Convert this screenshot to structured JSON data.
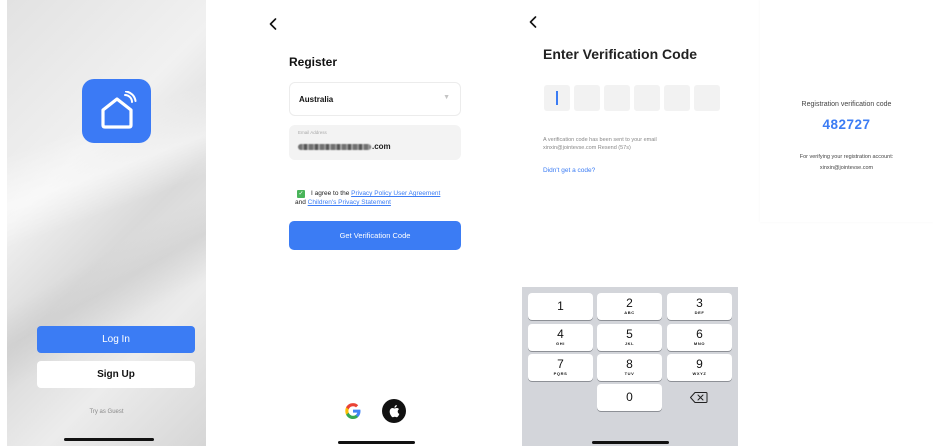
{
  "splash": {
    "login_label": "Log In",
    "signup_label": "Sign Up",
    "guest_label": "Try as Guest",
    "logo_icon": "smart-home-icon",
    "accent_color": "#3b7cf4"
  },
  "register": {
    "back_icon": "chevron-left-icon",
    "title": "Register",
    "country": "Australia",
    "email_placeholder": "Email Address",
    "email_value_visible": ".com",
    "agree_prefix": "I agree to the",
    "privacy_link": "Privacy Policy User Agreement",
    "and_text": "and",
    "children_link": "Children's Privacy Statement",
    "verify_button": "Get Verification Code",
    "social": [
      "google-icon",
      "apple-icon"
    ]
  },
  "verify": {
    "back_icon": "chevron-left-icon",
    "title": "Enter Verification Code",
    "code_length": 6,
    "sent_line1": "A verification code has been sent to your email",
    "sent_line2": "xinxin@jointevse.com  Resend (57s)",
    "didnt_get": "Didn't get a code?",
    "keypad": [
      {
        "digit": "1",
        "letters": ""
      },
      {
        "digit": "2",
        "letters": "ABC"
      },
      {
        "digit": "3",
        "letters": "DEF"
      },
      {
        "digit": "4",
        "letters": "GHI"
      },
      {
        "digit": "5",
        "letters": "JKL"
      },
      {
        "digit": "6",
        "letters": "MNO"
      },
      {
        "digit": "7",
        "letters": "PQRS"
      },
      {
        "digit": "8",
        "letters": "TUV"
      },
      {
        "digit": "9",
        "letters": "WXYZ"
      },
      {
        "digit": "0",
        "letters": ""
      }
    ],
    "backspace_icon": "backspace-icon"
  },
  "email_card": {
    "label": "Registration verification code",
    "code": "482727",
    "for_text": "For verifying your registration account:",
    "account": "xinxin@jointevse.com"
  }
}
